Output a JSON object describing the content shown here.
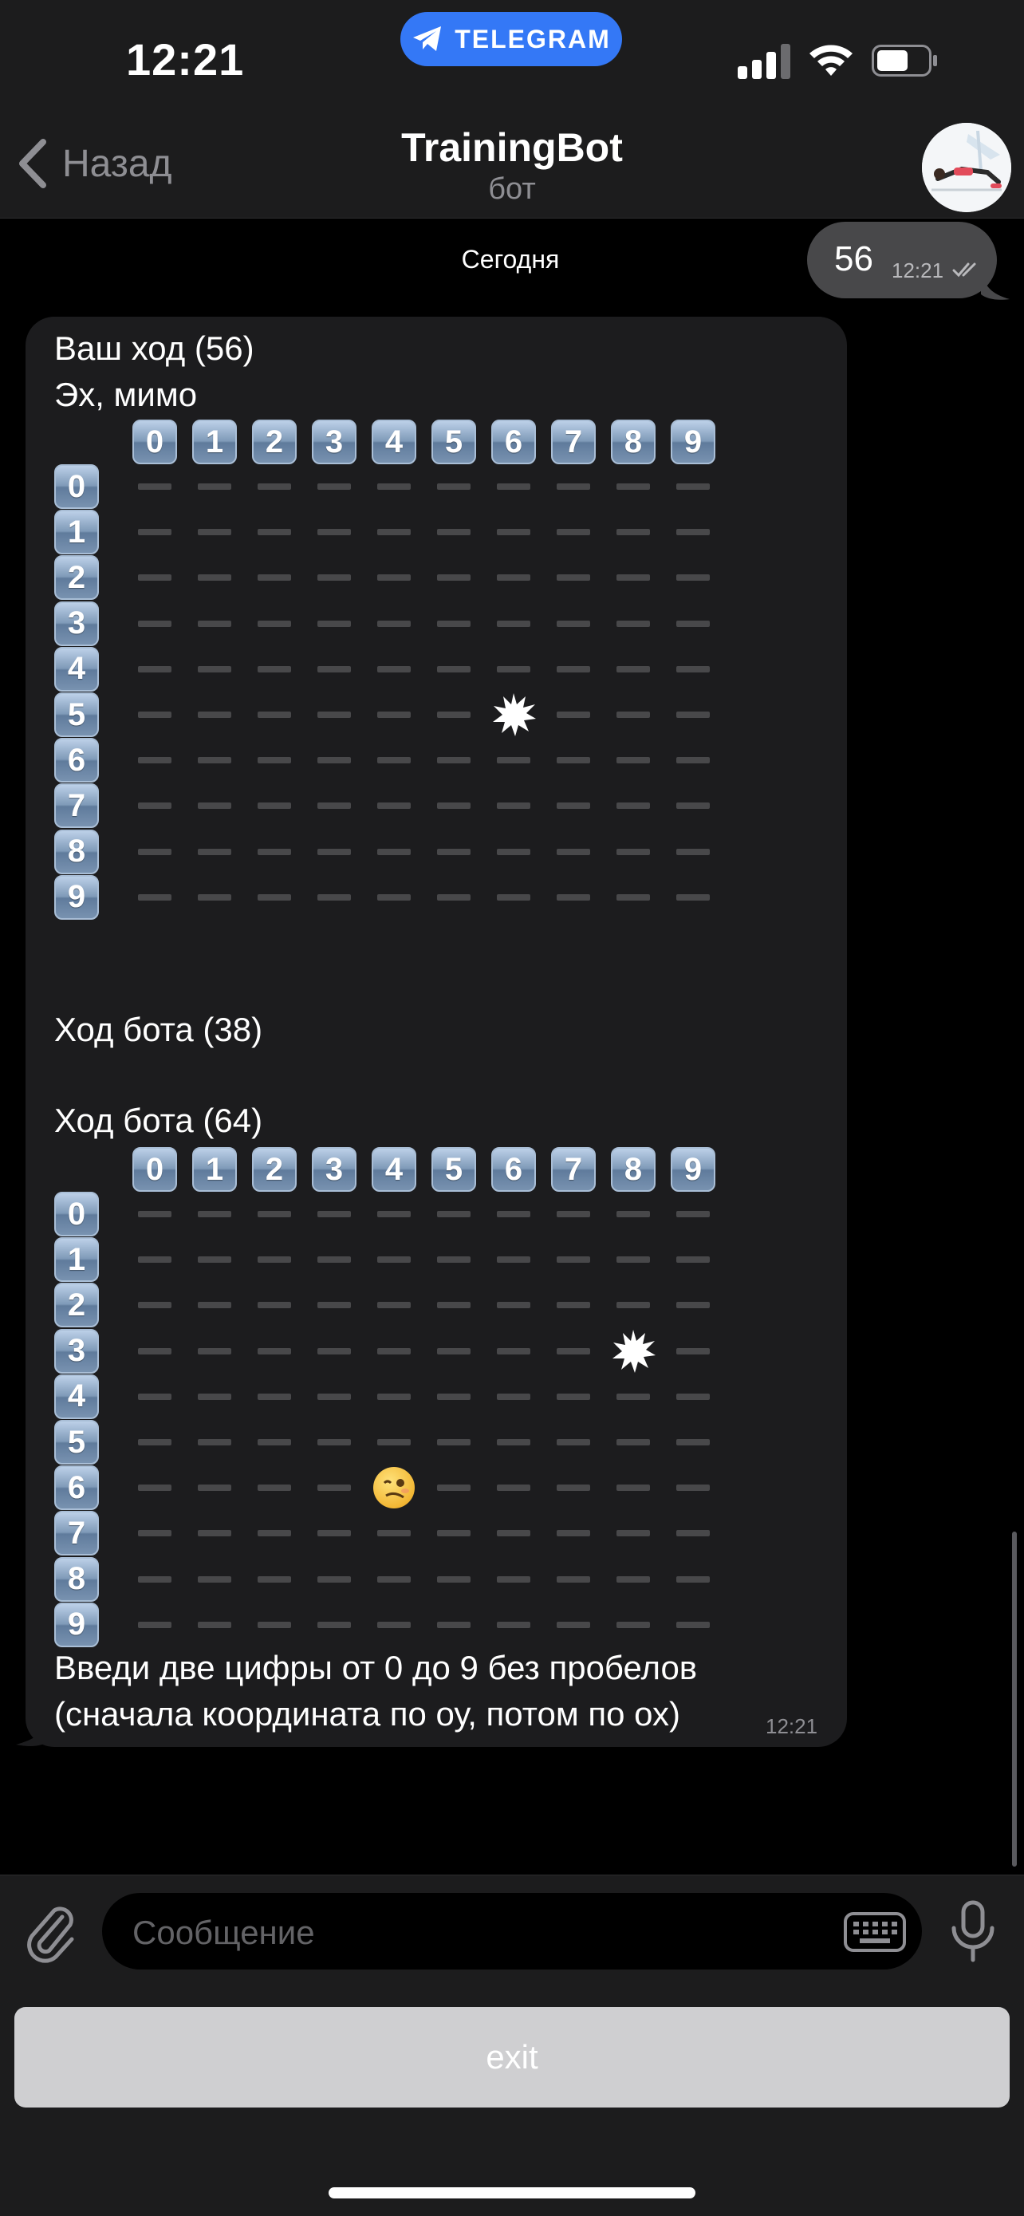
{
  "status_bar": {
    "time": "12:21",
    "app_pill": "TELEGRAM",
    "accent_color": "#3478f6"
  },
  "nav": {
    "back_label": "Назад",
    "title": "TrainingBot",
    "subtitle": "бот"
  },
  "chat": {
    "date_label": "Сегодня",
    "outgoing": {
      "text": "56",
      "time": "12:21",
      "status": "read"
    },
    "incoming": {
      "line1": "Ваш ход (56)",
      "line2": "Эх, мимо",
      "board1": {
        "col_labels": [
          "0",
          "1",
          "2",
          "3",
          "4",
          "5",
          "6",
          "7",
          "8",
          "9"
        ],
        "row_labels": [
          "0",
          "1",
          "2",
          "3",
          "4",
          "5",
          "6",
          "7",
          "8",
          "9"
        ],
        "marks": [
          {
            "row": 5,
            "col": 6,
            "kind": "miss-burst-icon"
          }
        ]
      },
      "line3": "Ход бота (38)",
      "line4": "Ход бота (64)",
      "board2": {
        "col_labels": [
          "0",
          "1",
          "2",
          "3",
          "4",
          "5",
          "6",
          "7",
          "8",
          "9"
        ],
        "row_labels": [
          "0",
          "1",
          "2",
          "3",
          "4",
          "5",
          "6",
          "7",
          "8",
          "9"
        ],
        "marks": [
          {
            "row": 3,
            "col": 8,
            "kind": "miss-burst-icon"
          },
          {
            "row": 6,
            "col": 4,
            "kind": "woozy-face-icon"
          }
        ]
      },
      "footer_line1": "Введи две цифры от 0 до 9 без пробелов",
      "footer_line2": "(сначала координата по оу, потом по ох)",
      "time": "12:21"
    }
  },
  "input": {
    "placeholder": "Сообщение"
  },
  "reply_keyboard": {
    "buttons": [
      "exit"
    ]
  }
}
